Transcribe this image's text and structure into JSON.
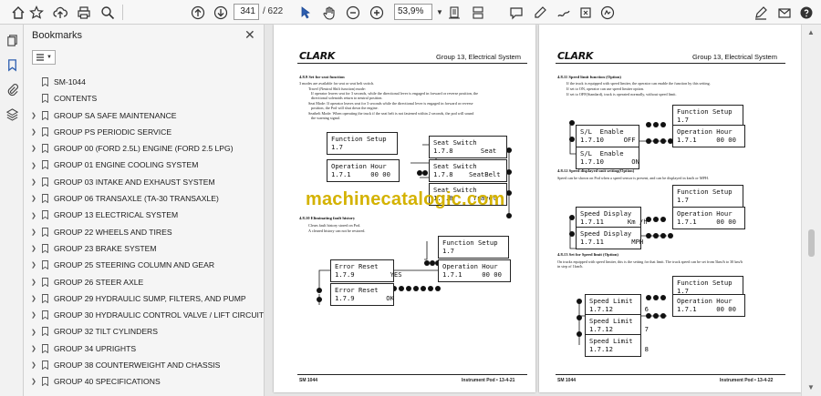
{
  "toolbar": {
    "current_page": "341",
    "total_pages": "/ 622",
    "zoom": "53,9%"
  },
  "panel": {
    "title": "Bookmarks",
    "items": [
      {
        "label": "SM-1044",
        "expandable": false
      },
      {
        "label": "CONTENTS",
        "expandable": false
      },
      {
        "label": "GROUP SA SAFE MAINTENANCE",
        "expandable": true
      },
      {
        "label": "GROUP PS PERIODIC SERVICE",
        "expandable": true
      },
      {
        "label": "GROUP 00 (FORD 2.5L) ENGINE (FORD 2.5 LPG)",
        "expandable": true
      },
      {
        "label": "GROUP 01 ENGINE COOLING SYSTEM",
        "expandable": true
      },
      {
        "label": "GROUP 03 INTAKE AND EXHAUST SYSTEM",
        "expandable": true
      },
      {
        "label": "GROUP 06 TRANSAXLE (TA-30 TRANSAXLE)",
        "expandable": true
      },
      {
        "label": "GROUP 13 ELECTRICAL SYSTEM",
        "expandable": true
      },
      {
        "label": "GROUP 22 WHEELS AND TIRES",
        "expandable": true
      },
      {
        "label": "GROUP 23 BRAKE SYSTEM",
        "expandable": true
      },
      {
        "label": "GROUP 25 STEERING COLUMN AND GEAR",
        "expandable": true
      },
      {
        "label": "GROUP 26 STEER AXLE",
        "expandable": true
      },
      {
        "label": "GROUP 29 HYDRAULIC SUMP, FILTERS, AND PUMP",
        "expandable": true
      },
      {
        "label": "GROUP 30 HYDRAULIC CONTROL VALVE / LIFT CIRCUIT",
        "expandable": true
      },
      {
        "label": "GROUP 32 TILT CYLINDERS",
        "expandable": true
      },
      {
        "label": "GROUP 34 UPRIGHTS",
        "expandable": true
      },
      {
        "label": "GROUP 38 COUNTERWEIGHT AND CHASSIS",
        "expandable": true
      },
      {
        "label": "GROUP 40 SPECIFICATIONS",
        "expandable": true
      }
    ]
  },
  "watermark": "machinecatalogic.com",
  "page_left": {
    "brand": "CLARK",
    "group": "Group 13, Electrical System",
    "sec1_title": "4.8.9 Set for seat function",
    "sec1_intro": "3 modes are available for seat or seat belt switch.",
    "sec1_b1": "Travel (Neutral Shift function) mode:",
    "sec1_b1a": "If operator leaves seat for 3 seconds, while the directional lever is engaged in forward or reverse position, the",
    "sec1_b1b": "directional solenoids return to neutral position.",
    "sec1_b2": "Seat Mode: If operator leaves seat for 3 seconds while the directional lever is engaged in forward or reverse",
    "sec1_b2a": "position, the Pod will shut down the engine.",
    "sec1_b3": "Seatbelt Mode: When operating the truck if the seat belt is not fastened within 2 seconds, the pod will sound",
    "sec1_b3a": "the warning signal.",
    "lcd_fs_1": "Function Setup\n1.7",
    "lcd_oh_1": "Operation Hour\n1.7.1     00 00",
    "lcd_ss_seat": "Seat Switch\n1.7.8       Seat",
    "lcd_ss_belt": "Seat Switch\n1.7.8    SeatBelt",
    "lcd_ss_trav": "Seat Switch\n1.7.8     Travel",
    "sec2_title": "4.8.10 Eliminating fault history",
    "sec2_b1": "Clears fault history stored on Pod.",
    "sec2_b2": "A cleared history can not be restored.",
    "lcd_fs_2": "Function Setup\n1.7",
    "lcd_er_yes": "Error Reset\n1.7.9         YES",
    "lcd_oh_2": "Operation Hour\n1.7.1     00 00",
    "lcd_er_ok": "Error Reset\n1.7.9        OK",
    "foot_left": "SM 1044",
    "foot_right": "Instrument Pod • 13-4-21"
  },
  "page_right": {
    "brand": "CLARK",
    "group": "Group 13, Electrical System",
    "sec1_title": "4.8.11 Speed limit function (Option)",
    "sec1_b1": "If the truck is equipped with speed limiter, the operator can enable the function by this setting.",
    "sec1_b2": "If set to ON, operator can use speed limiter option.",
    "sec1_b3": "If set to OFF(Standard), truck is operated normally, without speed limit.",
    "lcd_fs_1": "Function Setup\n1.7",
    "lcd_sl_off": "S/L  Enable\n1.7.10     OFF",
    "lcd_oh_1": "Operation Hour\n1.7.1     00 00",
    "lcd_sl_on": "S/L  Enable\n1.7.10       ON",
    "sec2_title": "4.8.12 Speed displayed unit setting(Option)",
    "sec2_intro": "Speed can be shown on Pod when a speed sensor is present, and can be displayed in km/h or MPH.",
    "lcd_fs_2": "Function Setup\n1.7",
    "lcd_sd_km": "Speed Display\n1.7.11      Km /h",
    "lcd_oh_2": "Operation Hour\n1.7.1     00 00",
    "lcd_sd_mph": "Speed Display\n1.7.11       MPH",
    "sec3_title": "4.8.13 Set for Speed limit (Option)",
    "sec3_intro": "On trucks equipped with speed limiter, this is the setting for that limit. The truck speed can be set from 5km/h to 30 km/h",
    "sec3_intro2": "in step of 1km/h.",
    "lcd_fs_3": "Function Setup\n1.7",
    "lcd_sp_6": "Speed Limit\n1.7.12        6",
    "lcd_oh_3": "Operation Hour\n1.7.1     00 00",
    "lcd_sp_7": "Speed Limit\n1.7.12        7",
    "lcd_sp_8": "Speed Limit\n1.7.12        8",
    "foot_left": "SM 1044",
    "foot_right": "Instrument Pod • 13-4-22"
  },
  "colors": {
    "watermark": "#d4b200",
    "toolbar": "#f7f7f7",
    "panel": "#f5f5f5",
    "viewer": "#e6e6e6"
  }
}
